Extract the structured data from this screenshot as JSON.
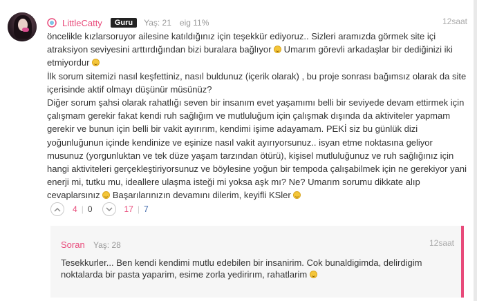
{
  "post": {
    "username": "LittleCatty",
    "badge": "Guru",
    "age": "Yaş: 21",
    "match": "eig 11%",
    "time": "12saat",
    "paragraphs": [
      [
        "öncelikle kızlarsoruyor ailesine katıldığınız için teşekkür ediyoruz.. Sizleri aramızda görmek site içi atraksiyon seviyesini arttırdığından bizi buralara bağlıyor ",
        "emoji",
        " Umarım görevli arkadaşlar bir dediğinizi iki etmiyordur ",
        "emoji"
      ],
      [
        "İlk sorum sitemizi nasıl keşfettiniz, nasıl buldunuz (içerik olarak) , bu proje sonrası bağımsız olarak da site içerisinde aktif olmayı düşünür müsünüz?"
      ],
      [
        "Diğer sorum şahsi olarak rahatlığı seven bir insanım evet yaşamımı belli bir seviyede devam ettirmek için çalışmam gerekir fakat kendi ruh sağlığım ve mutluluğum için çalışmak dışında da aktiviteler yapmam gerekir ve bunun için belli bir vakit ayırırım, kendimi işime adayamam. PEKİ siz bu günlük dizi yoğunluğunun içinde kendinize ve eşinize nasıl vakit ayırıyorsunuz.. isyan etme noktasına geliyor musunuz (yorgunluktan ve tek düze yaşam tarzından ötürü), kişisel mutluluğunuz ve ruh sağlığınız için hangi aktiviteleri gerçekleştiriyorsunuz ve böylesine yoğun bir tempoda çalışabilmek için ne gerekiyor yani enerji mi, tutku mu, ideallere ulaşma isteği mi yoksa aşk mı? Ne? Umarım sorumu dikkate alıp cevaplarsınız ",
        "emoji",
        " Başarılarınızın devamını dilerim, keyifli KSler ",
        "emoji"
      ]
    ],
    "votes": {
      "up_pink": "4",
      "up_gray": "0",
      "down_pink": "17",
      "down_blue": "7"
    }
  },
  "reply": {
    "username": "Soran",
    "age": "Yaş: 28",
    "time": "12saat",
    "text": [
      "Tesekkurler... Ben kendi kendimi mutlu edebilen bir insanirim. Cok bunaldigimda, delirdigim noktalarda bir pasta yaparim, esime zorla yedirirım, rahatlarim ",
      "emoji"
    ]
  },
  "colors": {
    "accent": "#e84a7a",
    "badge_bg": "#222222",
    "link_blue": "#3a64a8"
  },
  "icons": [
    "level-icon",
    "avatar",
    "thumbs-up-icon",
    "thumbs-down-icon",
    "smile-emoji-icon"
  ]
}
